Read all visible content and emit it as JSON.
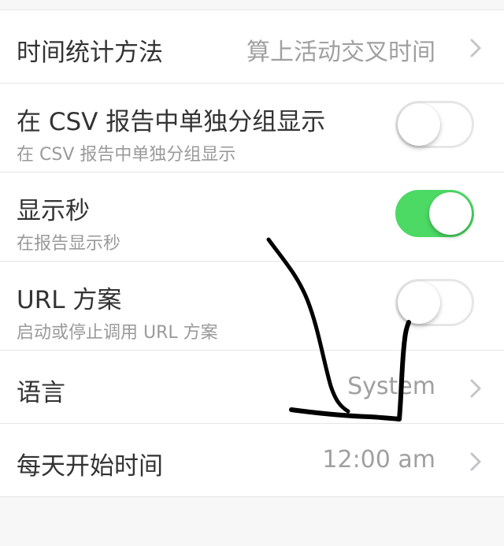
{
  "settings": {
    "time_stat": {
      "title": "时间统计方法",
      "value": "算上活动交叉时间",
      "icon": "chevron-right-icon"
    },
    "csv_group": {
      "title": "在 CSV 报告中单独分组显示",
      "subtitle": "在 CSV 报告中单独分组显示",
      "enabled": false
    },
    "show_seconds": {
      "title": "显示秒",
      "subtitle": "在报告显示秒",
      "enabled": true
    },
    "url_scheme": {
      "title": "URL 方案",
      "subtitle": "启动或停止调用 URL 方案",
      "enabled": false
    },
    "language": {
      "title": "语言",
      "value": "System",
      "icon": "chevron-right-icon"
    },
    "day_start": {
      "title": "每天开始时间",
      "value": "12:00 am",
      "icon": "chevron-right-icon"
    }
  },
  "colors": {
    "switch_on": "#4cd964",
    "switch_off_border": "#e6e6e6",
    "title_text": "#333333",
    "secondary_text": "#9a9a9a",
    "annotation_stroke": "#000000"
  }
}
